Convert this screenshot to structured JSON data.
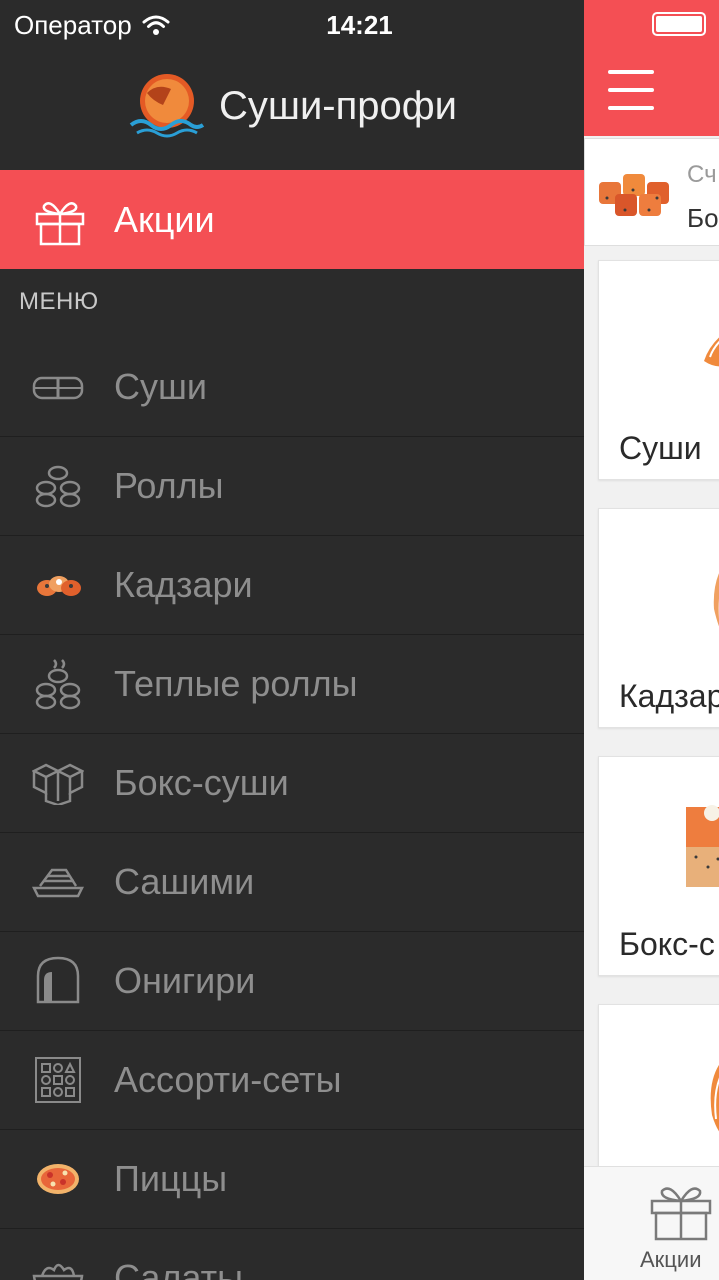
{
  "status": {
    "carrier": "Оператор",
    "time": "14:21"
  },
  "brand": {
    "name": "Суши-профи"
  },
  "promo": {
    "label": "Акции"
  },
  "menu_header": "МЕНЮ",
  "menu": [
    {
      "label": "Суши",
      "icon": "sushi-icon"
    },
    {
      "label": "Роллы",
      "icon": "rolls-icon"
    },
    {
      "label": "Кадзари",
      "icon": "kadzari-icon"
    },
    {
      "label": "Теплые роллы",
      "icon": "warm-rolls-icon"
    },
    {
      "label": "Бокс-суши",
      "icon": "box-sushi-icon"
    },
    {
      "label": "Сашими",
      "icon": "sashimi-icon"
    },
    {
      "label": "Онигири",
      "icon": "onigiri-icon"
    },
    {
      "label": "Ассорти-сеты",
      "icon": "assorti-sets-icon"
    },
    {
      "label": "Пиццы",
      "icon": "pizza-icon"
    },
    {
      "label": "Салаты",
      "icon": "salad-icon"
    }
  ],
  "main": {
    "order_card": {
      "line1": "Сч",
      "line2": "Бо"
    },
    "categories": [
      {
        "label": "Суши"
      },
      {
        "label": "Кадзар"
      },
      {
        "label": "Бокс-с"
      },
      {
        "label": ""
      }
    ],
    "tab": {
      "label": "Акции"
    }
  },
  "colors": {
    "accent": "#f44f54",
    "drawer_bg": "#2b2b2b",
    "menu_text": "#8e8e8e"
  }
}
